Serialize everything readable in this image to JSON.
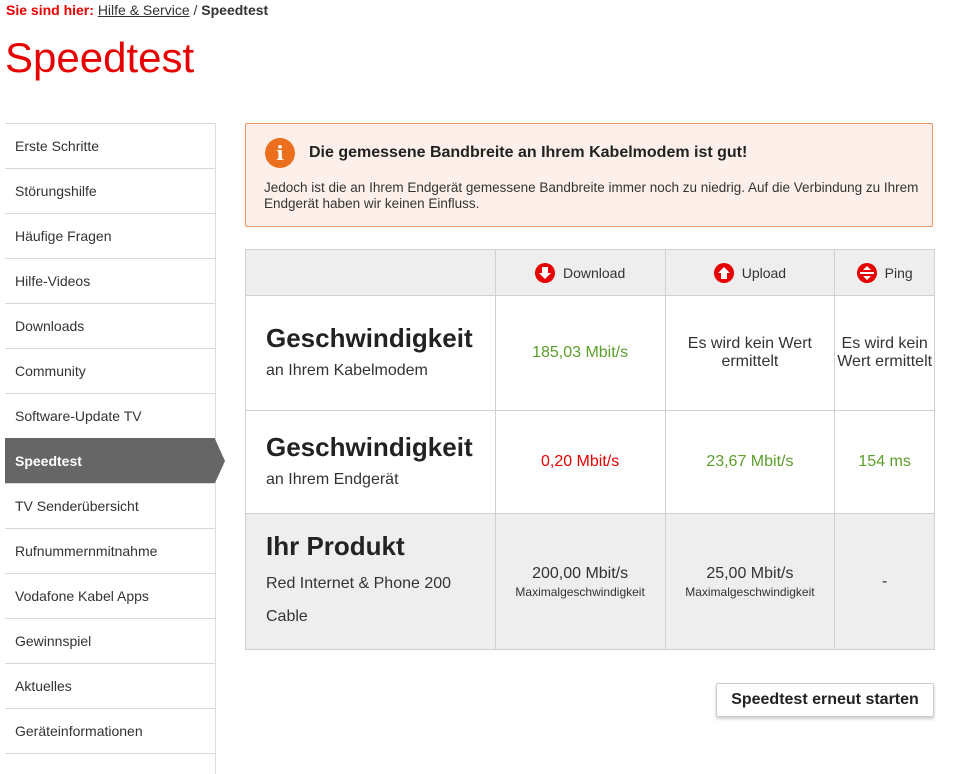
{
  "breadcrumb": {
    "label": "Sie sind hier:",
    "link": "Hilfe & Service",
    "separator": "/",
    "current": "Speedtest"
  },
  "page_title": "Speedtest",
  "sidebar": {
    "items": [
      {
        "label": "Erste Schritte"
      },
      {
        "label": "Störungshilfe"
      },
      {
        "label": "Häufige Fragen"
      },
      {
        "label": "Hilfe-Videos"
      },
      {
        "label": "Downloads"
      },
      {
        "label": "Community"
      },
      {
        "label": "Software-Update TV"
      },
      {
        "label": "Speedtest",
        "active": true
      },
      {
        "label": "TV Senderübersicht"
      },
      {
        "label": "Rufnummernmitnahme"
      },
      {
        "label": "Vodafone Kabel Apps"
      },
      {
        "label": "Gewinnspiel"
      },
      {
        "label": "Aktuelles"
      },
      {
        "label": "Geräteinformationen"
      }
    ]
  },
  "alert": {
    "icon": "info-icon",
    "title": "Die gemessene Bandbreite an Ihrem Kabelmodem ist gut!",
    "text": "Jedoch ist die an Ihrem Endgerät gemessene Bandbreite immer noch zu niedrig. Auf die Verbindung zu Ihrem Endgerät haben wir keinen Einfluss."
  },
  "table": {
    "headers": {
      "download": "Download",
      "upload": "Upload",
      "ping": "Ping"
    },
    "rows": [
      {
        "title": "Geschwindigkeit",
        "subtitle": "an Ihrem Kabelmodem",
        "download": "185,03 Mbit/s",
        "upload": "Es wird kein Wert ermittelt",
        "ping": "Es wird kein Wert ermittelt"
      },
      {
        "title": "Geschwindigkeit",
        "subtitle": "an Ihrem Endgerät",
        "download": "0,20 Mbit/s",
        "upload": "23,67 Mbit/s",
        "ping": "154 ms"
      },
      {
        "title": "Ihr Produkt",
        "subtitle": "Red Internet & Phone 200 Cable",
        "download": "200,00 Mbit/s",
        "download_note": "Maximalgeschwindigkeit",
        "upload": "25,00 Mbit/s",
        "upload_note": "Maximalgeschwindigkeit",
        "ping": "-"
      }
    ]
  },
  "restart_button": "Speedtest erneut starten",
  "colors": {
    "brand_red": "#e60000",
    "good_green": "#5d9e2a",
    "alert_orange": "#eb6f1c"
  }
}
